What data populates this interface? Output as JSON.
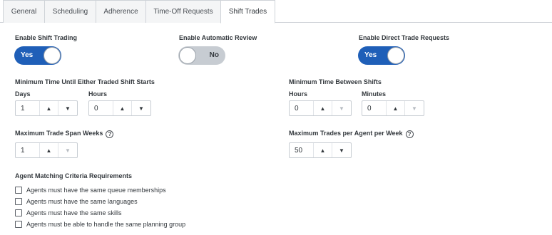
{
  "tabs": [
    {
      "label": "General"
    },
    {
      "label": "Scheduling"
    },
    {
      "label": "Adherence"
    },
    {
      "label": "Time-Off Requests"
    },
    {
      "label": "Shift Trades"
    }
  ],
  "toggles": {
    "shift_trading": {
      "label": "Enable Shift Trading",
      "value": "Yes",
      "on": true
    },
    "automatic_review": {
      "label": "Enable Automatic Review",
      "value": "No",
      "on": false
    },
    "direct_trade": {
      "label": "Enable Direct Trade Requests",
      "value": "Yes",
      "on": true
    }
  },
  "min_time_traded": {
    "label": "Minimum Time Until Either Traded Shift Starts",
    "days": {
      "label": "Days",
      "value": "1"
    },
    "hours": {
      "label": "Hours",
      "value": "0"
    }
  },
  "min_time_between": {
    "label": "Minimum Time Between Shifts",
    "hours": {
      "label": "Hours",
      "value": "0"
    },
    "minutes": {
      "label": "Minutes",
      "value": "0"
    }
  },
  "max_span": {
    "label": "Maximum Trade Span Weeks",
    "value": "1"
  },
  "max_trades": {
    "label": "Maximum Trades per Agent per Week",
    "value": "50"
  },
  "help_glyph": "?",
  "arrows": {
    "up": "▲",
    "down": "▼"
  },
  "criteria": {
    "label": "Agent Matching Criteria Requirements",
    "items": [
      {
        "label": "Agents must have the same queue memberships",
        "checked": false
      },
      {
        "label": "Agents must have the same languages",
        "checked": false
      },
      {
        "label": "Agents must have the same skills",
        "checked": false
      },
      {
        "label": "Agents must be able to handle the same planning group",
        "checked": false
      }
    ]
  }
}
